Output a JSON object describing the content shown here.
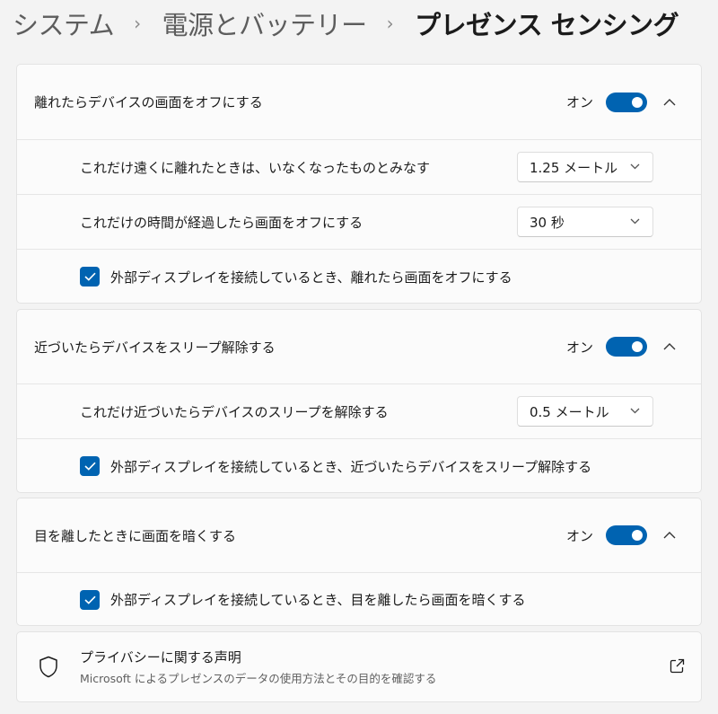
{
  "breadcrumb": {
    "item1": "システム",
    "item2": "電源とバッテリー",
    "current": "プレゼンス センシング",
    "separator": "›"
  },
  "section1": {
    "title": "離れたらデバイスの画面をオフにする",
    "toggle_state": "オン",
    "toggle_on": true,
    "distance_label": "これだけ遠くに離れたときは、いなくなったものとみなす",
    "distance_value": "1.25 メートル",
    "time_label": "これだけの時間が経過したら画面をオフにする",
    "time_value": "30 秒",
    "checkbox_label": "外部ディスプレイを接続しているとき、離れたら画面をオフにする",
    "checkbox_checked": true
  },
  "section2": {
    "title": "近づいたらデバイスをスリープ解除する",
    "toggle_state": "オン",
    "toggle_on": true,
    "distance_label": "これだけ近づいたらデバイスのスリープを解除する",
    "distance_value": "0.5 メートル",
    "checkbox_label": "外部ディスプレイを接続しているとき、近づいたらデバイスをスリープ解除する",
    "checkbox_checked": true
  },
  "section3": {
    "title": "目を離したときに画面を暗くする",
    "toggle_state": "オン",
    "toggle_on": true,
    "checkbox_label": "外部ディスプレイを接続しているとき、目を離したら画面を暗くする",
    "checkbox_checked": true
  },
  "privacy": {
    "title": "プライバシーに関する声明",
    "subtitle": "Microsoft によるプレゼンスのデータの使用方法とその目的を確認する"
  },
  "colors": {
    "accent": "#0063b1",
    "background": "#f3f3f3",
    "card": "#fbfbfb"
  }
}
